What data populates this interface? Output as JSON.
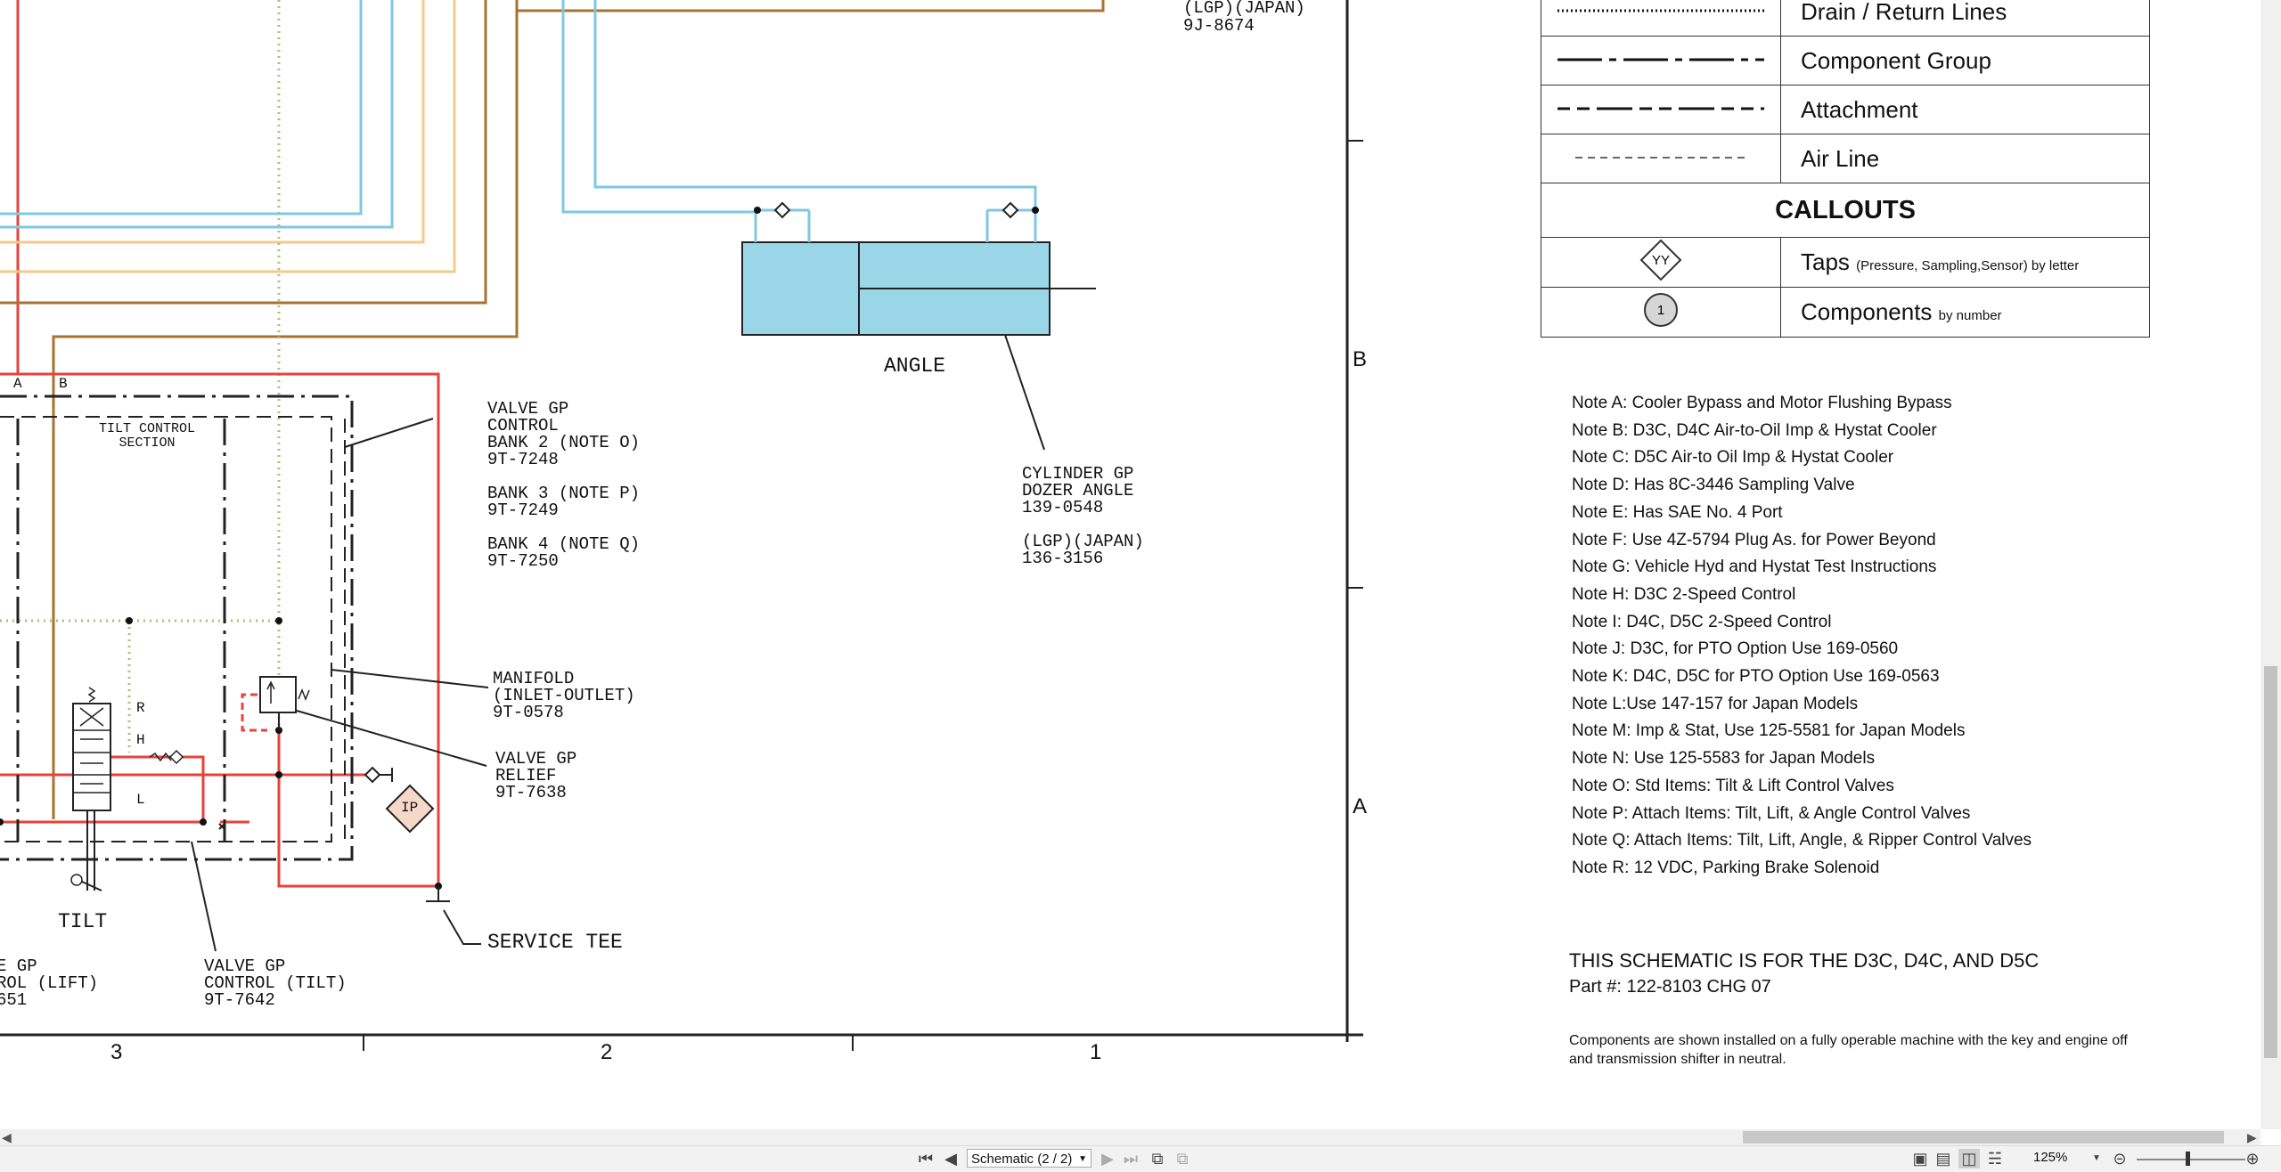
{
  "schematic": {
    "top_callout_1": "(LGP)(JAPAN)",
    "top_callout_2": "9J-8674",
    "angle_label": "ANGLE",
    "cyl_lines": [
      "CYLINDER GP",
      "DOZER ANGLE",
      "139-0548"
    ],
    "cyl_lgp_lines": [
      "(LGP)(JAPAN)",
      "136-3156"
    ],
    "valve_gp_lines": [
      "VALVE GP",
      "CONTROL",
      "BANK 2 (NOTE O)",
      "9T-7248"
    ],
    "bank3_lines": [
      "BANK 3 (NOTE P)",
      "9T-7249"
    ],
    "bank4_lines": [
      "BANK 4 (NOTE Q)",
      "9T-7250"
    ],
    "manifold_lines": [
      "MANIFOLD",
      "(INLET-OUTLET)",
      "9T-0578"
    ],
    "relief_lines": [
      "VALVE GP",
      "RELIEF",
      "9T-7638"
    ],
    "service_tee": "SERVICE TEE",
    "tilt_section_lines": [
      "TILT CONTROL",
      "SECTION"
    ],
    "port_a": "A",
    "port_b": "B",
    "port_r": "R",
    "port_h": "H",
    "port_l": "L",
    "tilt_label": "TILT",
    "ip_tap": "IP",
    "lift_lines": [
      "E GP",
      "ROL (LIFT)",
      "651"
    ],
    "tilt_valve_lines": [
      "VALVE GP",
      "CONTROL (TILT)",
      "9T-7642"
    ],
    "zone_b": "B",
    "zone_a": "A",
    "col_3": "3",
    "col_2": "2",
    "col_1": "1"
  },
  "legend": {
    "rows": [
      {
        "label": "Drain / Return Lines",
        "line_style": "dotted"
      },
      {
        "label": "Component Group",
        "line_style": "dash-dot"
      },
      {
        "label": "Attachment",
        "line_style": "long-dash"
      },
      {
        "label": "Air Line",
        "line_style": "thin-dash"
      }
    ],
    "callouts_heading": "CALLOUTS",
    "taps_label": "Taps",
    "taps_small": "(Pressure, Sampling,Sensor) by letter",
    "taps_symbol": "YY",
    "components_label": "Components",
    "components_small": "by number",
    "components_symbol": "1"
  },
  "notes": [
    "Note A: Cooler Bypass and Motor Flushing Bypass",
    "Note B: D3C, D4C   Air-to-Oil Imp & Hystat Cooler",
    "Note C: D5C  Air-to Oil Imp & Hystat Cooler",
    "Note D: Has 8C-3446 Sampling Valve",
    "Note E: Has SAE No. 4 Port",
    "Note F: Use 4Z-5794 Plug As. for Power Beyond",
    "Note G: Vehicle Hyd and Hystat Test Instructions",
    "Note H: D3C 2-Speed Control",
    "Note I: D4C, D5C 2-Speed Control",
    "Note J: D3C, for PTO Option Use 169-0560",
    "Note K: D4C, D5C for PTO Option Use 169-0563",
    "Note L:Use 147-157 for Japan Models",
    "Note M: Imp & Stat, Use 125-5581 for Japan Models",
    "Note N: Use 125-5583 for Japan Models",
    "Note O: Std Items: Tilt & Lift Control Valves",
    "Note P: Attach Items: Tilt, Lift, & Angle Control Valves",
    "Note Q: Attach Items: Tilt, Lift, Angle, & Ripper Control Valves",
    "Note R: 12 VDC, Parking Brake Solenoid"
  ],
  "title_note": "THIS SCHEMATIC IS FOR THE D3C, D4C, AND D5C",
  "part_number": "Part #: 122-8103 CHG 07",
  "footnote": "Components are shown installed on a fully operable machine with the key and engine off and transmission shifter in neutral.",
  "toolbar": {
    "page_select": "Schematic (2 / 2)",
    "zoom": "125%"
  },
  "colors": {
    "pressure": "#e8423c",
    "supply": "#7ec8e3",
    "brown": "#a8732e",
    "orange_light": "#f5c98c",
    "cylinder_fill": "#98d6e8",
    "drain": "#a8c07a"
  }
}
